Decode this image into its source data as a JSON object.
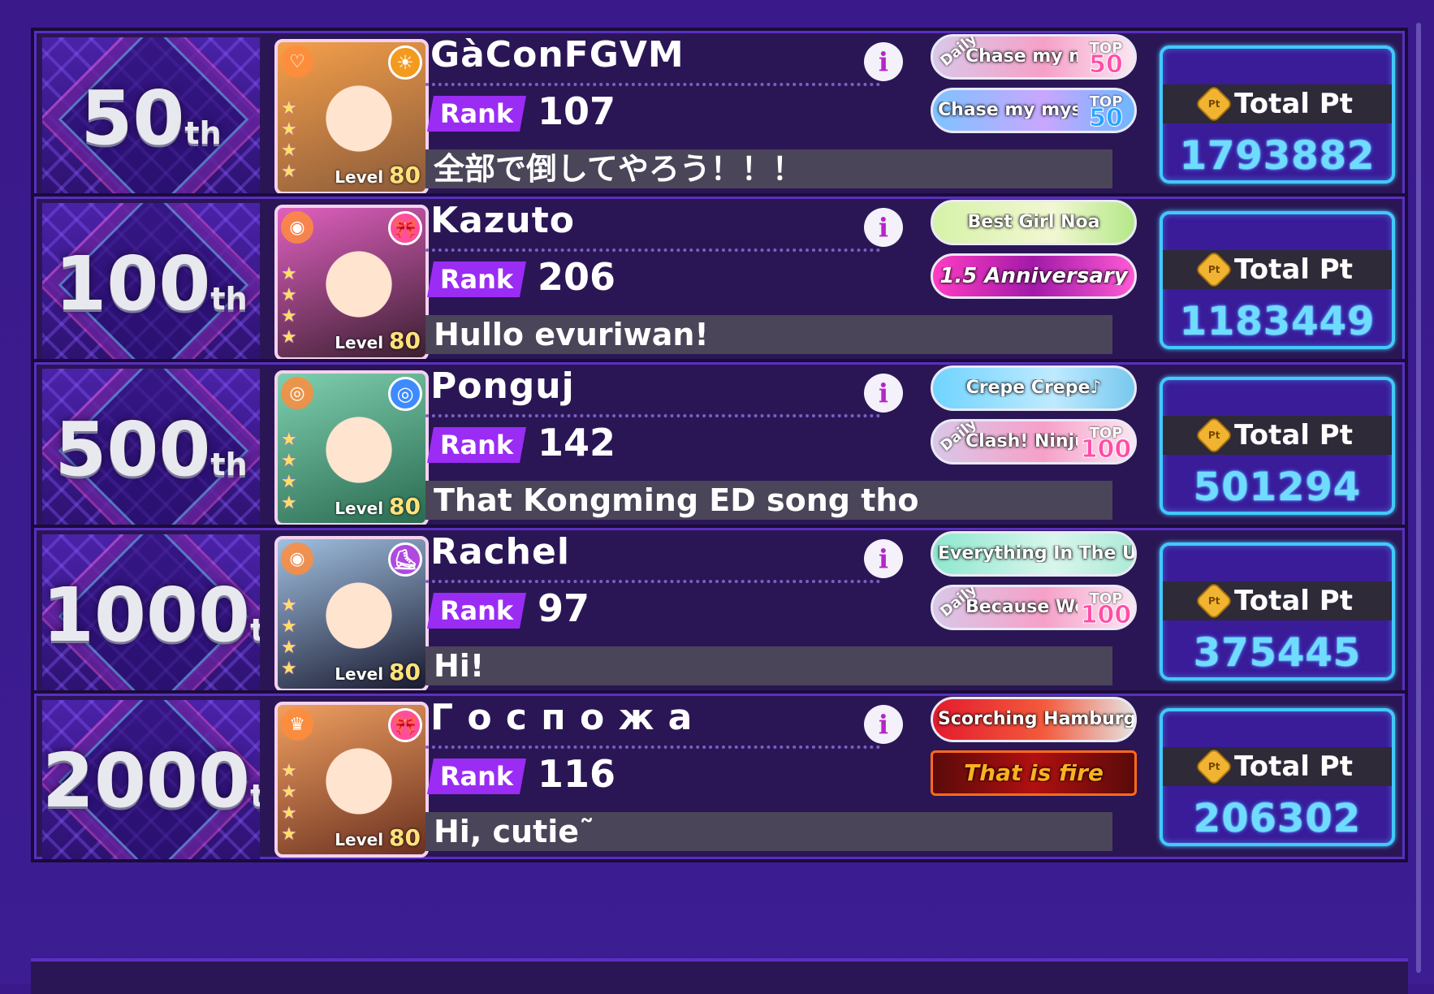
{
  "colors": {
    "background": "#3a1a8a",
    "row_bg": "#2a1655",
    "rank_tag": "#9a2cf4",
    "points_value": "#6fdcff",
    "points_border": "#43c9ff"
  },
  "leaderboard": [
    {
      "place": "50",
      "suffix": "th",
      "name": "GàConFGVM",
      "rank_label": "Rank",
      "rank": "107",
      "comment": "全部で倒してやろう！！！",
      "card": {
        "level_label": "Level",
        "level": "80",
        "attribute_icon": "sun-icon",
        "band_icon": "heart-shield-icon",
        "stars": 4,
        "colors": [
          "#f5a04a",
          "#8a5a3a"
        ]
      },
      "titles": [
        {
          "daily": "Daily",
          "name": "Chase my mysterious cute creature",
          "top_label": "TOP",
          "top": "50",
          "style": "daily"
        },
        {
          "daily": "",
          "name": "Chase my mysterious cute creature",
          "top_label": "TOP",
          "top": "50",
          "style": "winged"
        }
      ],
      "points_label": "Total Pt",
      "points": "1793882"
    },
    {
      "place": "100",
      "suffix": "th",
      "name": "Kazuto",
      "rank_label": "Rank",
      "rank": "206",
      "comment": "Hullo evuriwan!",
      "card": {
        "level_label": "Level",
        "level": "80",
        "attribute_icon": "ribbon-icon",
        "band_icon": "spiral-icon",
        "stars": 4,
        "colors": [
          "#e060c0",
          "#3a2030"
        ]
      },
      "titles": [
        {
          "daily": "",
          "name": "Best Girl Noa",
          "top_label": "",
          "top": "",
          "style": "bestgirl"
        },
        {
          "daily": "",
          "name": "1.5 Anniversary",
          "top_label": "",
          "top": "",
          "style": "anniv"
        }
      ],
      "points_label": "Total Pt",
      "points": "1183449"
    },
    {
      "place": "500",
      "suffix": "th",
      "name": "Ponguj",
      "rank_label": "Rank",
      "rank": "142",
      "comment": "That Kongming ED song tho",
      "card": {
        "level_label": "Level",
        "level": "80",
        "attribute_icon": "swirl-icon",
        "band_icon": "target-icon",
        "stars": 4,
        "colors": [
          "#7fd0b0",
          "#2a6a50"
        ]
      },
      "titles": [
        {
          "daily": "",
          "name": "Crepe Crepe♪",
          "top_label": "",
          "top": "",
          "style": "crepe"
        },
        {
          "daily": "Daily",
          "name": "Clash! Ninjutsu Battle Kunoichi!",
          "top_label": "TOP",
          "top": "100",
          "style": "daily"
        }
      ],
      "points_label": "Total Pt",
      "points": "501294"
    },
    {
      "place": "1000",
      "suffix": "th",
      "name": "Rachel",
      "rank_label": "Rank",
      "rank": "97",
      "comment": "Hi!",
      "card": {
        "level_label": "Level",
        "level": "80",
        "attribute_icon": "shoe-icon",
        "band_icon": "spiral-icon",
        "stars": 4,
        "colors": [
          "#a0c0e0",
          "#1a1a30"
        ]
      },
      "titles": [
        {
          "daily": "",
          "name": "Everything In The Universe",
          "top_label": "",
          "top": "",
          "style": "universe"
        },
        {
          "daily": "Daily",
          "name": "Because We Can't Play It Alone",
          "top_label": "TOP",
          "top": "100",
          "style": "daily"
        }
      ],
      "points_label": "Total Pt",
      "points": "375445"
    },
    {
      "place": "2000",
      "suffix": "th",
      "name": "Г о с п о ж а",
      "rank_label": "Rank",
      "rank": "116",
      "comment": "Hi, cutie˜",
      "card": {
        "level_label": "Level",
        "level": "80",
        "attribute_icon": "ribbon-icon",
        "band_icon": "crown-icon",
        "stars": 4,
        "colors": [
          "#f0a060",
          "#6a3020"
        ]
      },
      "titles": [
        {
          "daily": "",
          "name": "Scorching Hamburger",
          "top_label": "",
          "top": "",
          "style": "burger"
        },
        {
          "daily": "",
          "name": "That is fire",
          "top_label": "",
          "top": "",
          "style": "fire"
        }
      ],
      "points_label": "Total Pt",
      "points": "206302"
    }
  ]
}
